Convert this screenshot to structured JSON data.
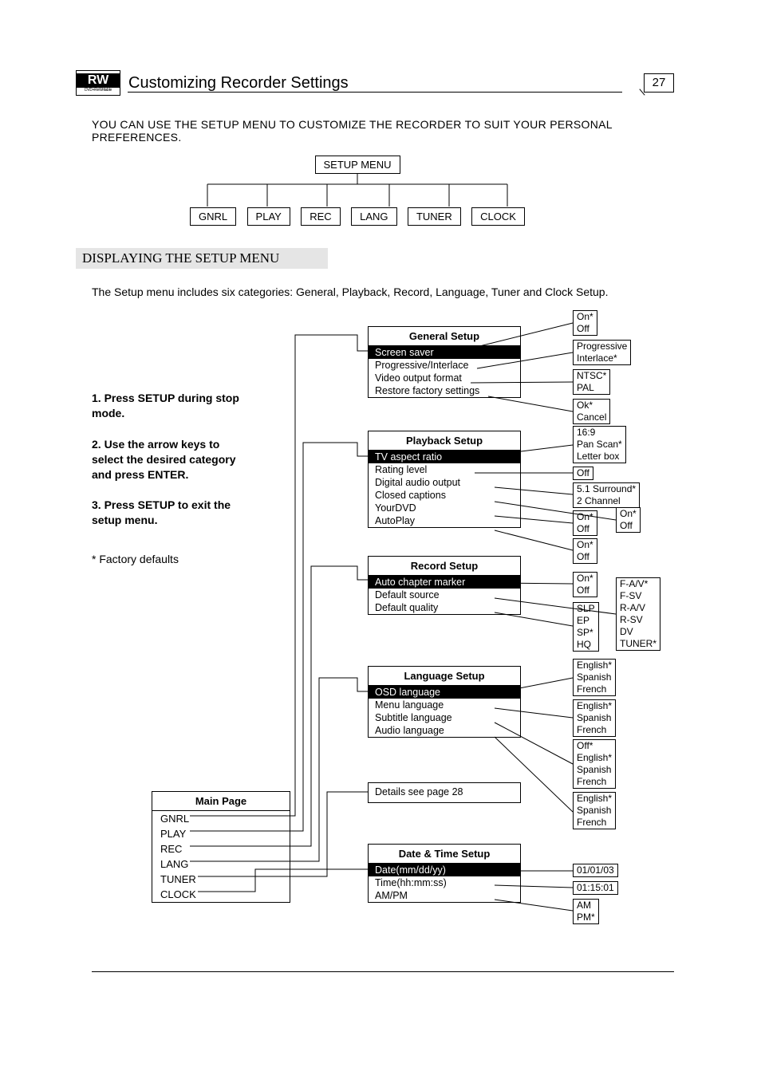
{
  "page_number": "27",
  "badge": {
    "big": "RW",
    "small": "DVD+ReWritable"
  },
  "title": "Customizing Recorder Settings",
  "intro": "YOU CAN USE THE SETUP MENU TO CUSTOMIZE THE RECORDER TO SUIT YOUR PERSONAL PREFERENCES.",
  "tree_root": "SETUP MENU",
  "tree_leaves": [
    "GNRL",
    "PLAY",
    "REC",
    "LANG",
    "TUNER",
    "CLOCK"
  ],
  "section_heading": "DISPLAYING THE SETUP MENU",
  "section_para": "The Setup menu includes six categories: General, Playback, Record, Language, Tuner and Clock Setup.",
  "steps": [
    "1. Press SETUP during stop mode.",
    "2. Use the arrow keys to select the desired category and press  ENTER.",
    "3. Press SETUP to exit the setup menu."
  ],
  "note": "* Factory defaults",
  "mainpage": {
    "title": "Main Page",
    "items": [
      "GNRL",
      "PLAY",
      "REC",
      "LANG",
      "TUNER",
      "CLOCK"
    ]
  },
  "groups": {
    "general": {
      "title": "General Setup",
      "items": [
        {
          "label": "Screen saver",
          "sel": true
        },
        {
          "label": "Progressive/Interlace"
        },
        {
          "label": "Video output format"
        },
        {
          "label": "Restore factory settings"
        }
      ]
    },
    "playback": {
      "title": "Playback Setup",
      "items": [
        {
          "label": "TV aspect ratio",
          "sel": true
        },
        {
          "label": "Rating level"
        },
        {
          "label": "Digital audio output"
        },
        {
          "label": "Closed captions"
        },
        {
          "label": "YourDVD"
        },
        {
          "label": "AutoPlay"
        }
      ]
    },
    "record": {
      "title": "Record Setup",
      "items": [
        {
          "label": "Auto chapter marker",
          "sel": true
        },
        {
          "label": "Default source"
        },
        {
          "label": "Default quality"
        }
      ]
    },
    "language": {
      "title": "Language Setup",
      "items": [
        {
          "label": "OSD language",
          "sel": true
        },
        {
          "label": "Menu language"
        },
        {
          "label": "Subtitle language"
        },
        {
          "label": "Audio language"
        }
      ]
    },
    "tuner_detail": "Details see page 28",
    "clock": {
      "title": "Date & Time Setup",
      "items": [
        {
          "label": "Date(mm/dd/yy)",
          "sel": true
        },
        {
          "label": "Time(hh:mm:ss)"
        },
        {
          "label": "AM/PM"
        }
      ]
    }
  },
  "opts": {
    "screen_saver": [
      "On*",
      "Off"
    ],
    "prog_inter": [
      "Progressive",
      "Interlace*"
    ],
    "video_out": [
      "NTSC*",
      "PAL"
    ],
    "restore": [
      "Ok*",
      "Cancel"
    ],
    "tv_aspect": [
      "16:9",
      "Pan Scan*",
      "Letter box"
    ],
    "rating": [
      "Off"
    ],
    "digital_audio": [
      "5.1 Surround*",
      "2 Channel"
    ],
    "closed_captions": [
      "On*",
      "Off"
    ],
    "yourdvd": [
      "On*",
      "Off"
    ],
    "autoplay": [
      "On*",
      "Off"
    ],
    "auto_chapter": [
      "On*",
      "Off"
    ],
    "default_source1": [
      "F-A/V*",
      "F-SV",
      "R-A/V",
      "R-SV",
      "DV",
      "TUNER*"
    ],
    "default_quality": [
      "SLP",
      "EP",
      "SP*",
      "HQ"
    ],
    "osd_lang": [
      "English*",
      "Spanish",
      "French"
    ],
    "menu_lang": [
      "English*",
      "Spanish",
      "French"
    ],
    "subtitle_lang": [
      "Off*",
      "English*",
      "Spanish",
      "French"
    ],
    "audio_lang": [
      "English*",
      "Spanish",
      "French"
    ],
    "date": [
      "01/01/03"
    ],
    "time": [
      "01:15:01"
    ],
    "ampm": [
      "AM",
      "PM*"
    ]
  }
}
